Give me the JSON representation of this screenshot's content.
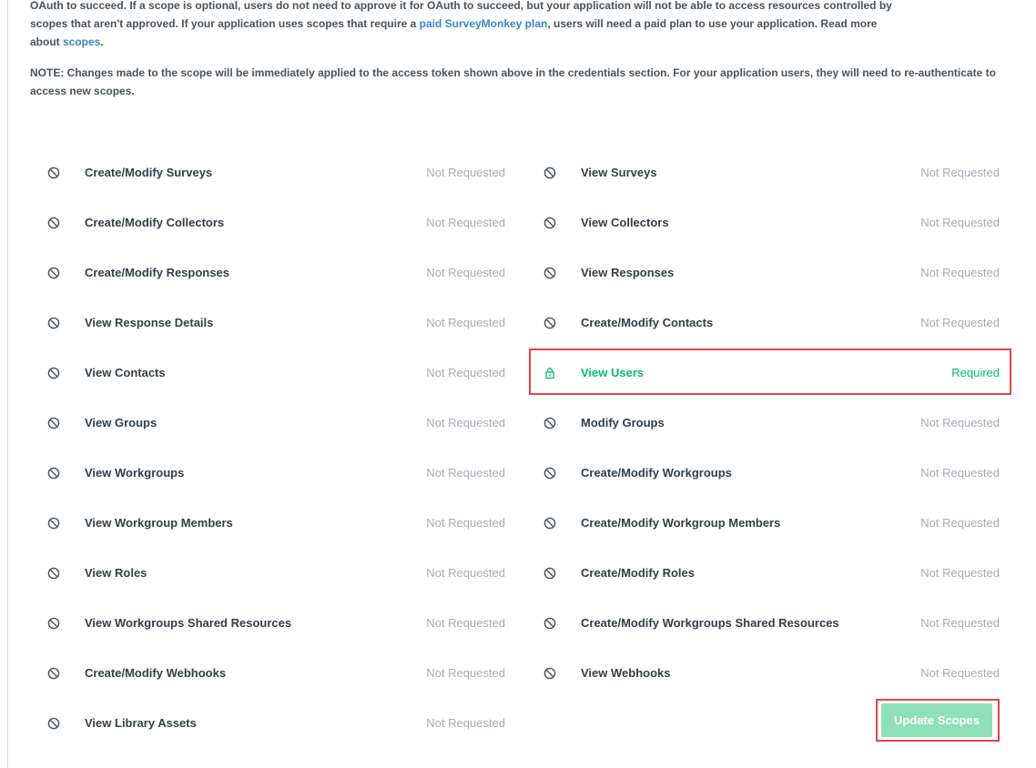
{
  "intro": {
    "line1_partial": "OAuth to succeed. If a scope is optional, users do not need to approve it for OAuth to succeed, but your application will not be able to access resources controlled by",
    "line2_a": "scopes that aren't approved. If your application uses scopes that require a ",
    "paid_plan_link": "paid SurveyMonkey plan",
    "line2_b": ", users will need a paid plan to use your application. Read more",
    "line3_a": "about ",
    "scopes_link": "scopes",
    "line3_b": "."
  },
  "note": "NOTE: Changes made to the scope will be immediately applied to the access token shown above in the credentials section. For your application users, they will need to re-authenticate to access new scopes.",
  "colors": {
    "required": "#00bf6f",
    "not_requested": "#a5adb4",
    "link": "#3b85c6",
    "highlight": "#e8434a",
    "button_bg": "#8fdfb8"
  },
  "left_scopes": [
    {
      "name": "Create/Modify Surveys",
      "status": "Not Requested",
      "icon": "blocked-icon"
    },
    {
      "name": "Create/Modify Collectors",
      "status": "Not Requested",
      "icon": "blocked-icon"
    },
    {
      "name": "Create/Modify Responses",
      "status": "Not Requested",
      "icon": "blocked-icon"
    },
    {
      "name": "View Response Details",
      "status": "Not Requested",
      "icon": "blocked-icon"
    },
    {
      "name": "View Contacts",
      "status": "Not Requested",
      "icon": "blocked-icon"
    },
    {
      "name": "View Groups",
      "status": "Not Requested",
      "icon": "blocked-icon"
    },
    {
      "name": "View Workgroups",
      "status": "Not Requested",
      "icon": "blocked-icon"
    },
    {
      "name": "View Workgroup Members",
      "status": "Not Requested",
      "icon": "blocked-icon"
    },
    {
      "name": "View Roles",
      "status": "Not Requested",
      "icon": "blocked-icon"
    },
    {
      "name": "View Workgroups Shared Resources",
      "status": "Not Requested",
      "icon": "blocked-icon"
    },
    {
      "name": "Create/Modify Webhooks",
      "status": "Not Requested",
      "icon": "blocked-icon"
    },
    {
      "name": "View Library Assets",
      "status": "Not Requested",
      "icon": "blocked-icon"
    }
  ],
  "right_scopes": [
    {
      "name": "View Surveys",
      "status": "Not Requested",
      "icon": "blocked-icon"
    },
    {
      "name": "View Collectors",
      "status": "Not Requested",
      "icon": "blocked-icon"
    },
    {
      "name": "View Responses",
      "status": "Not Requested",
      "icon": "blocked-icon"
    },
    {
      "name": "Create/Modify Contacts",
      "status": "Not Requested",
      "icon": "blocked-icon"
    },
    {
      "name": "View Users",
      "status": "Required",
      "icon": "lock-icon"
    },
    {
      "name": "Modify Groups",
      "status": "Not Requested",
      "icon": "blocked-icon"
    },
    {
      "name": "Create/Modify Workgroups",
      "status": "Not Requested",
      "icon": "blocked-icon"
    },
    {
      "name": "Create/Modify Workgroup Members",
      "status": "Not Requested",
      "icon": "blocked-icon"
    },
    {
      "name": "Create/Modify Roles",
      "status": "Not Requested",
      "icon": "blocked-icon"
    },
    {
      "name": "Create/Modify Workgroups Shared Resources",
      "status": "Not Requested",
      "icon": "blocked-icon"
    },
    {
      "name": "View Webhooks",
      "status": "Not Requested",
      "icon": "blocked-icon"
    }
  ],
  "update_button": {
    "label": "Update Scopes"
  }
}
